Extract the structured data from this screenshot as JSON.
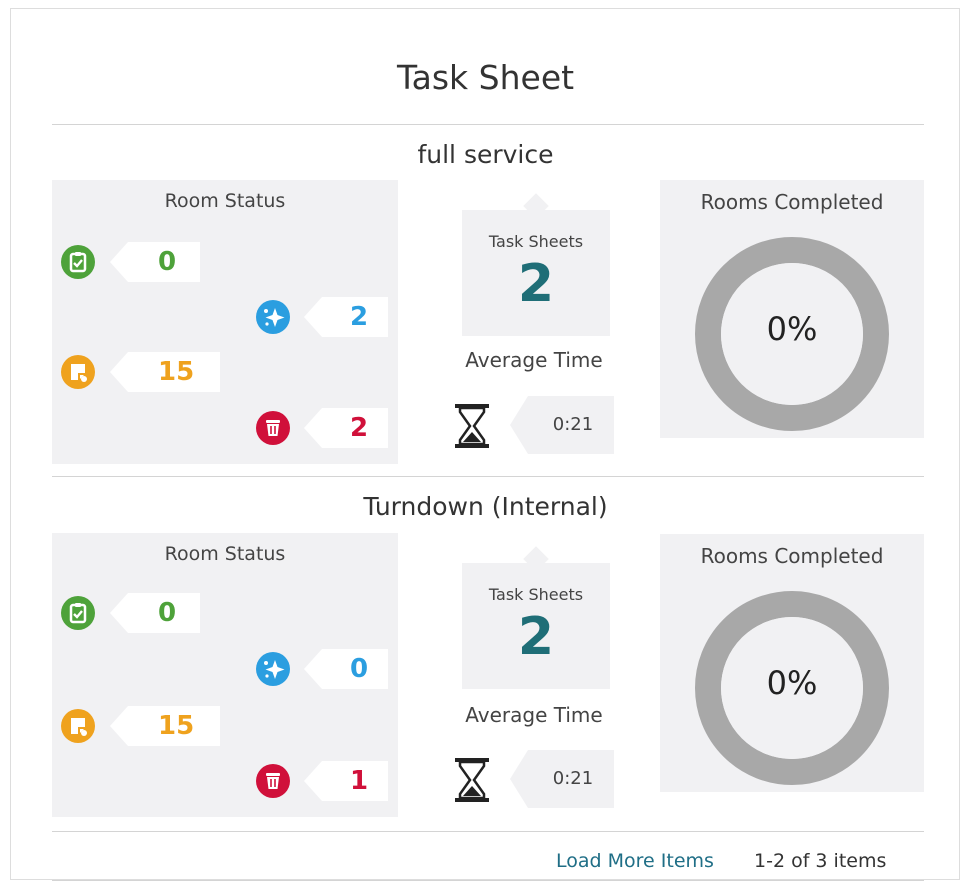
{
  "page": {
    "title": "Task Sheet"
  },
  "sections": [
    {
      "title": "full service",
      "room_status": {
        "label": "Room Status",
        "counts": {
          "clean": "0",
          "inspected": "2",
          "dirty": "15",
          "out_of_order": "2"
        }
      },
      "task_sheets": {
        "label": "Task Sheets",
        "value": "2"
      },
      "average_time": {
        "label": "Average Time",
        "value": "0:21"
      },
      "rooms_completed": {
        "label": "Rooms Completed",
        "value": "0%",
        "fraction": 0
      }
    },
    {
      "title": "Turndown (Internal)",
      "room_status": {
        "label": "Room Status",
        "counts": {
          "clean": "0",
          "inspected": "0",
          "dirty": "15",
          "out_of_order": "1"
        }
      },
      "task_sheets": {
        "label": "Task Sheets",
        "value": "2"
      },
      "average_time": {
        "label": "Average Time",
        "value": "0:21"
      },
      "rooms_completed": {
        "label": "Rooms Completed",
        "value": "0%",
        "fraction": 0
      }
    }
  ],
  "footer": {
    "load_more": "Load More Items",
    "count": "1-2 of 3 items"
  },
  "colors": {
    "clean": "#4ea23a",
    "inspected": "#2b9ee0",
    "dirty": "#efa21e",
    "out_of_order": "#d0103a",
    "teal": "#1f6e77",
    "donut": "#a8a8a8"
  },
  "icons": {
    "clean": "clipboard-check-icon",
    "inspected": "sparkle-icon",
    "dirty": "dirty-room-icon",
    "out_of_order": "trash-icon",
    "time": "hourglass-icon"
  }
}
